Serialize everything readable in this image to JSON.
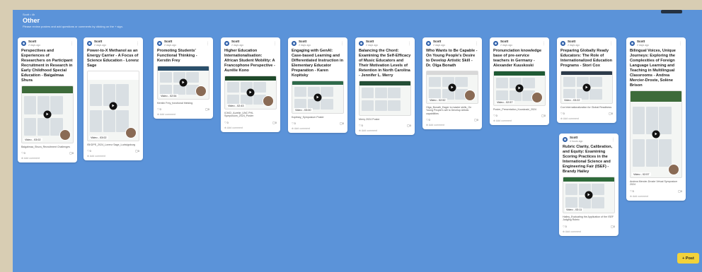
{
  "header": {
    "crumb": "Scott • 4h",
    "title": "Other",
    "desc": "Please review posters and add questions or comments by clicking on the + sign."
  },
  "post_button": "+ Post",
  "add_comment_label": "Add comment",
  "colors": {
    "board": "#5b93d9",
    "post_button": "#f2d23a"
  },
  "cards": [
    {
      "author": "Scott",
      "time": "2 days ago",
      "title": "Perspectives and Experiences of Researchers on Participant Recruitment in Research in Early Childhood Special Education - Baigalmaa Shura",
      "video": "Video - 03:02",
      "file": "Baigalmaa_Shura_Recruitment Challenges",
      "likes": "0",
      "comments": "0",
      "band": "#3d6b3a"
    },
    {
      "author": "Scott",
      "time": "2 days ago",
      "title": "Power-to-X Methanol as an Energy Carrier - A Focus of Science Education - Lorenz Sage",
      "video": "Video - 03:02",
      "file": "ISKDPE_2024_Lorenz Sage_Ludwigsburg",
      "likes": "0",
      "comments": "0",
      "band": "#ffffff"
    },
    {
      "author": "Scott",
      "time": "2 days ago",
      "title": "Promoting Students' Functional Thinking - Kerstin Frey",
      "video": "Video - 02:54",
      "file": "Kerstin Frey_functional thinking",
      "likes": "0",
      "comments": "0",
      "band": "#2b4f6b"
    },
    {
      "author": "Scott",
      "time": "2 days ago",
      "title": "Higher Education Internationalisation: African Student Mobility: A Francophone Perspective - Aurélie Kono",
      "video": "Video - 02:43",
      "file": "ICMCI_Aurélie_UNC PHL Symposium_2024_Poster",
      "likes": "0",
      "comments": "0",
      "band": "#1f4a2a"
    },
    {
      "author": "Scott",
      "time": "2 days ago",
      "title": "Engaging with GenAI: Case-based Learning and Differentiated Instruction in Elementary Educator Preparation - Karen Kopitsky",
      "video": "Video - 03:00",
      "file": "Kopitsky_Symposium Poster",
      "likes": "0",
      "comments": "0",
      "band": "#2f6a4a"
    },
    {
      "author": "Scott",
      "time": "2 days ago",
      "title": "Balancing the Chord: Examining the Self-Efficacy of Music Educators and Their Motivation Levels of Retention in North Carolina - Jennifer L. Merry",
      "video": "",
      "file": "Merry 2024 Poster",
      "likes": "0",
      "comments": "0",
      "band": "#244f36"
    },
    {
      "author": "Scott",
      "time": "2 days ago",
      "title": "Who Wants to Be Capable - On Young People's Desire to Develop Artistic Skill - Dr. Olga Bonath",
      "video": "Video - 02:52",
      "file": "Olga_Bonath_Eager to master skills_On Young People's will to Develop Artistic capabilities",
      "likes": "0",
      "comments": "0",
      "band": "#d8d8d8"
    },
    {
      "author": "Scott",
      "time": "2 days ago",
      "title": "Pronunciation knowledge base of pre-service teachers in Germany - Alexander Kuuskoski",
      "video": "Video - 02:57",
      "file": "Poster_Presentation_Kuuskoski_2024",
      "likes": "0",
      "comments": "0",
      "band": "#1f5a34"
    },
    {
      "author": "Scott",
      "time": "2 days ago",
      "title": "Preparing Globally Ready Educators: The Role of Internationalized Education Programs - Stori Cox",
      "video": "Video - 03:22",
      "file": "Cox Internationalization for Global Readiness",
      "likes": "0",
      "comments": "0",
      "band": "#2d3b4a"
    },
    {
      "author": "Scott",
      "time": "4 hours ago",
      "title": "Rubric Clarity, Calibration, and Equity: Examining Scoring Practices in the International Science and Engineering Fair (ISEF) - Brandy Hailey",
      "video": "Video - 03:11",
      "file": "Hailey_Evaluating the Application of the ISEF Judging Rubric",
      "likes": "0",
      "comments": "0",
      "band": "#2f6a3a"
    },
    {
      "author": "Scott",
      "time": "2 days ago",
      "title": "Bilingual Voices, Unique Journeys: Exploring the Complexities of Foreign Language Learning and Teaching in Multilingual Classrooms - Andrea Mercier-Droste, Solène Brison",
      "video": "Video - 02:57",
      "file": "Andrea Mercier-Droste Virtual Symposium 2024",
      "likes": "0",
      "comments": "0",
      "band": "#3d6b3a"
    }
  ]
}
